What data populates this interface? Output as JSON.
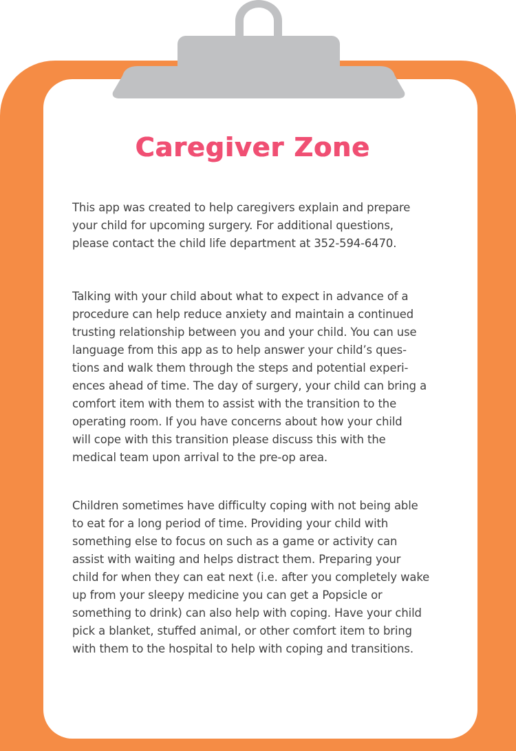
{
  "title": "Caregiver Zone",
  "colors": {
    "board": "#f58c45",
    "title": "#f04f73",
    "clip": "#c0c1c3",
    "text": "#3f3f3f"
  },
  "paragraphs": [
    {
      "lines": [
        "This app was created to help caregivers explain and prepare",
        "your child for upcoming surgery. For additional questions,",
        "please contact the child life department at 352-594-6470."
      ]
    },
    {
      "lines": [
        "Talking with your child about what to expect in advance of a",
        "procedure can help reduce anxiety and maintain a continued",
        "trusting relationship between you and your child.  You can use",
        "language from this app as to help answer your child’s ques-",
        "tions and walk them through the steps and potential experi-",
        "ences ahead of time.  The day of surgery, your child can bring a",
        "comfort item with them to assist with the transition to the",
        "operating room.  If you have concerns about how your child",
        "will cope with this transition please discuss this with the",
        "medical team upon arrival to the pre-op area."
      ]
    },
    {
      "lines": [
        "Children sometimes have difficulty coping with not being able",
        "to eat for a long period of time.  Providing your child with",
        "something else to focus on such as a game or activity can",
        "assist with waiting and helps distract them.  Preparing your",
        "child for when they can eat next (i.e. after you completely wake",
        "up from your sleepy medicine you can get a Popsicle or",
        "something to drink) can also help with coping.  Have your child",
        "pick a blanket, stuffed animal, or other comfort item to bring",
        "with them to the hospital to help with coping and transitions."
      ]
    }
  ]
}
